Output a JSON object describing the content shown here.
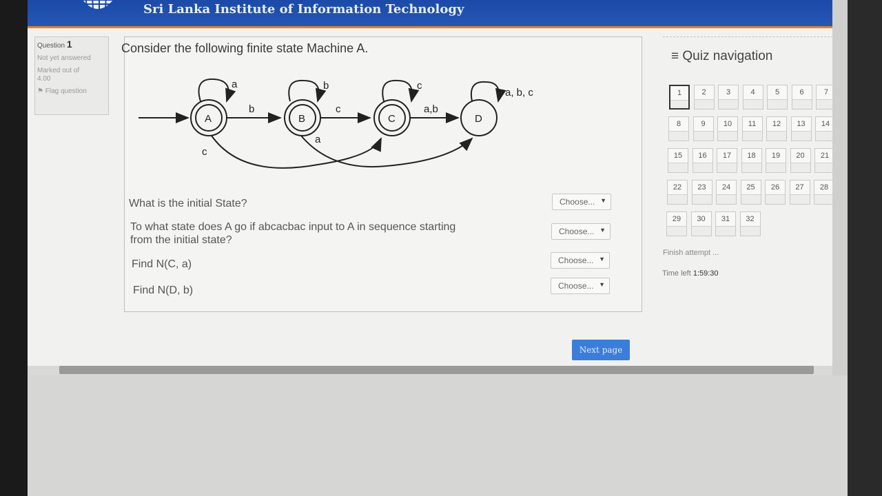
{
  "header": {
    "title": "Sri Lanka Institute of Information Technology"
  },
  "question_info": {
    "label": "Question",
    "number": "1",
    "status": "Not yet answered",
    "marked": "Marked out of",
    "max_mark": "4.00",
    "flag": "Flag question"
  },
  "question": {
    "text": "Consider the following finite state Machine A.",
    "diagram": {
      "states": [
        "A",
        "B",
        "C",
        "D"
      ],
      "labels": {
        "loop_a": "a",
        "loop_b": "b",
        "loop_c": "c",
        "loop_d": "a,  b,  c",
        "ab": "b",
        "bc": "c",
        "cd": "a,b",
        "ac": "c",
        "bd": "a"
      }
    },
    "subquestions": [
      {
        "text": "What is the initial State?",
        "select": "Choose..."
      },
      {
        "text_line1": "To what state does A go if abcacbac input to A in sequence starting",
        "text_line2": "from the initial state?",
        "select": "Choose..."
      },
      {
        "text": "Find N(C, a)",
        "select": "Choose..."
      },
      {
        "text": "Find N(D, b)",
        "select": "Choose..."
      }
    ],
    "next_button": "Next page"
  },
  "quiz_nav": {
    "title": "Quiz navigation",
    "icon": "hamburger-icon",
    "current": "1",
    "buttons": [
      "1",
      "2",
      "3",
      "4",
      "5",
      "6",
      "7",
      "8",
      "9",
      "10",
      "11",
      "12",
      "13",
      "14",
      "15",
      "16",
      "17",
      "18",
      "19",
      "20",
      "21",
      "22",
      "23",
      "24",
      "25",
      "26",
      "27",
      "28",
      "29",
      "30",
      "31",
      "32"
    ],
    "finish": "Finish attempt ...",
    "time_left_label": "Time left",
    "time_left_value": "1:59:30"
  }
}
